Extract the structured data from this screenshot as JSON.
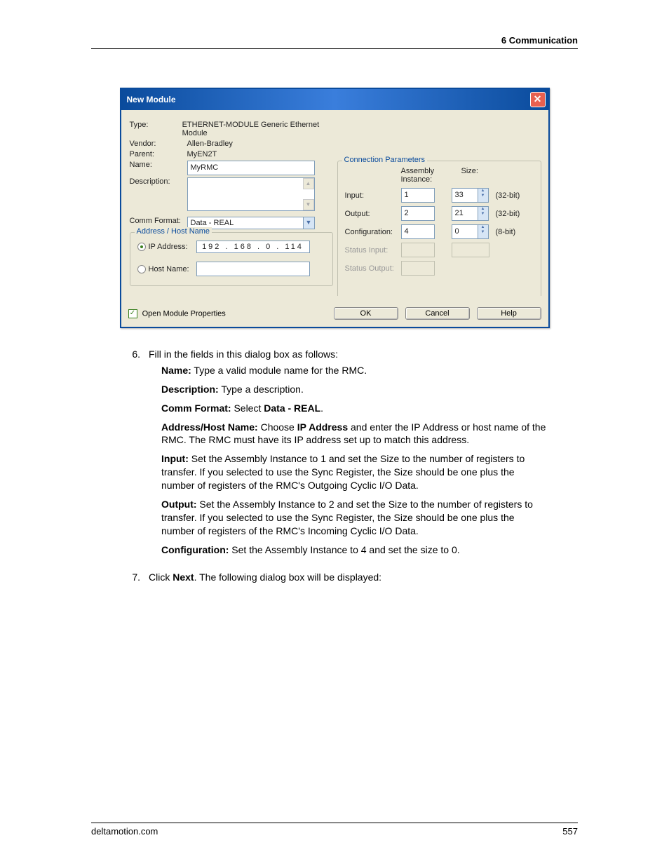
{
  "header": {
    "title": "6  Communication"
  },
  "dialog": {
    "title": "New Module",
    "labels": {
      "type": "Type:",
      "vendor": "Vendor:",
      "parent": "Parent:",
      "name": "Name:",
      "description": "Description:",
      "comm_format": "Comm Format:",
      "address_group": "Address / Host Name",
      "ip_address": "IP Address:",
      "host_name": "Host Name:",
      "open_props": "Open Module Properties",
      "conn_params": "Connection Parameters",
      "assembly_instance": "Assembly\nInstance:",
      "size": "Size:",
      "input": "Input:",
      "output": "Output:",
      "configuration": "Configuration:",
      "status_input": "Status Input:",
      "status_output": "Status Output:"
    },
    "values": {
      "type": "ETHERNET-MODULE Generic Ethernet Module",
      "vendor": "Allen-Bradley",
      "parent": "MyEN2T",
      "name": "MyRMC",
      "comm_format": "Data - REAL",
      "ip": "192 . 168 .   0  . 114",
      "input_instance": "1",
      "input_size": "33",
      "input_unit": "(32-bit)",
      "output_instance": "2",
      "output_size": "21",
      "output_unit": "(32-bit)",
      "config_instance": "4",
      "config_size": "0",
      "config_unit": "(8-bit)"
    },
    "buttons": {
      "ok": "OK",
      "cancel": "Cancel",
      "help": "Help"
    }
  },
  "instructions": {
    "step6_num": "6.",
    "step6_text": "Fill in the fields in this dialog box as follows:",
    "name_label": "Name:",
    "name_text": " Type a valid module name for the RMC.",
    "desc_label": "Description:",
    "desc_text": " Type a description.",
    "comm_label": "Comm Format:",
    "comm_text_pre": " Select ",
    "comm_value": "Data - REAL",
    "comm_text_post": ".",
    "addr_label": "Address/Host Name:",
    "addr_text_pre": " Choose ",
    "addr_value": "IP Address",
    "addr_text_post": " and enter the IP Address or host name of the RMC. The RMC must have its IP address set up to match this address.",
    "input_label": "Input:",
    "input_text": " Set the Assembly Instance to 1 and set the Size to the number of registers to transfer. If you selected to use the Sync Register, the Size should be one plus the number of registers of the RMC's Outgoing Cyclic I/O Data.",
    "output_label": "Output:",
    "output_text": " Set the Assembly Instance to 2 and set the Size to the number of registers to transfer. If you selected to use the Sync Register, the Size should be one plus the number of registers of the RMC's Incoming Cyclic I/O Data.",
    "config_label": "Configuration:",
    "config_text": " Set the Assembly Instance to 4 and set the size to 0.",
    "step7_num": "7.",
    "step7_text_pre": "Click ",
    "step7_value": "Next",
    "step7_text_post": ".  The following dialog box will be displayed:"
  },
  "footer": {
    "site": "deltamotion.com",
    "page": "557"
  }
}
